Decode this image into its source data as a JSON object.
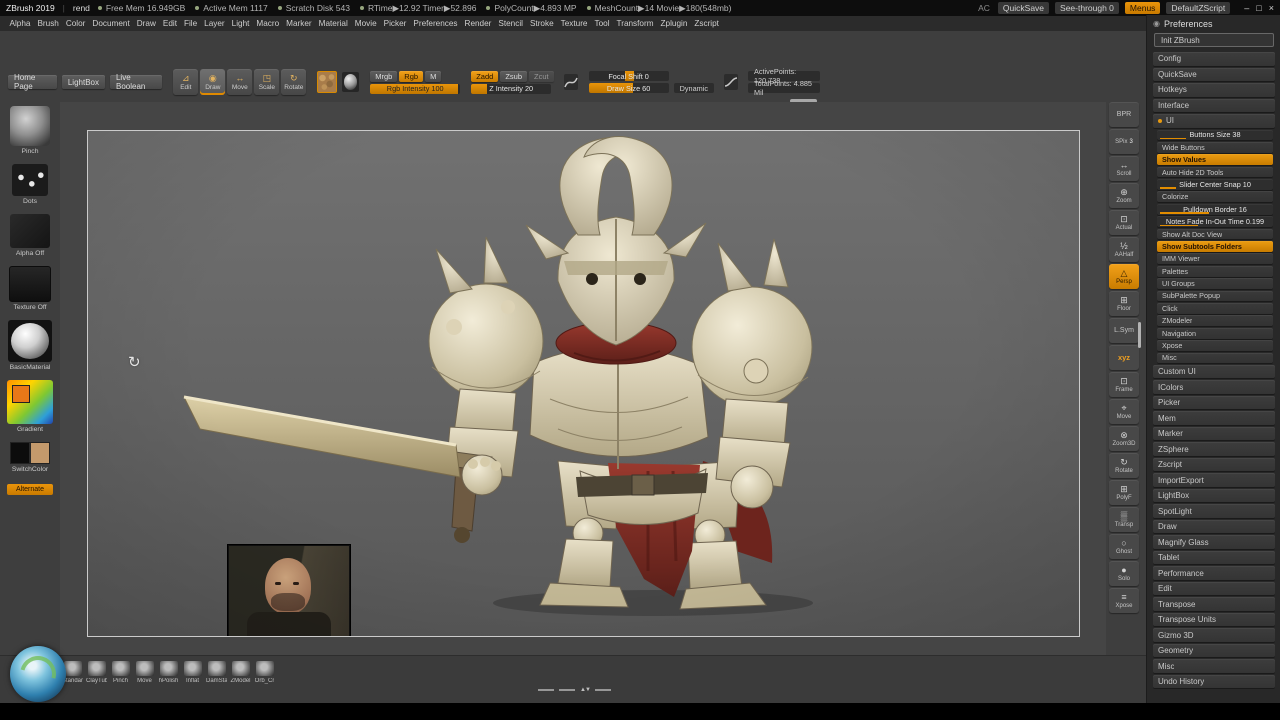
{
  "accent": "#d98a00",
  "titlebar": {
    "app_title": "ZBrush 2019",
    "doc_name": "rend",
    "stats": [
      "Free Mem 16.949GB",
      "Active Mem 1117",
      "Scratch Disk 543",
      "RTime▶12.92  Timer▶52.896",
      "PolyCount▶4.893 MP",
      "MeshCount▶14   Movie▶180(548mb)"
    ],
    "right_items": [
      {
        "label": "AC",
        "style": "plain"
      },
      {
        "label": "QuickSave"
      },
      {
        "label": "See-through 0"
      },
      {
        "label": "Menus",
        "style": "orange"
      },
      {
        "label": "DefaultZScript"
      }
    ],
    "window_controls": [
      "–",
      "□",
      "×"
    ]
  },
  "menubar": {
    "items": [
      "Alpha",
      "Brush",
      "Color",
      "Document",
      "Draw",
      "Edit",
      "File",
      "Layer",
      "Light",
      "Macro",
      "Marker",
      "Material",
      "Movie",
      "Picker",
      "Preferences",
      "Render",
      "Stencil",
      "Stroke",
      "Texture",
      "Tool",
      "Transform",
      "Zplugin",
      "Zscript"
    ]
  },
  "shelf": {
    "home_page": "Home Page",
    "lightbox": "LightBox",
    "live_boolean": "Live Boolean",
    "modes": [
      {
        "label": "Edit",
        "glyph": "⊿"
      },
      {
        "label": "Draw",
        "glyph": "◉",
        "active": true
      },
      {
        "label": "Move",
        "glyph": "↔"
      },
      {
        "label": "Scale",
        "glyph": "◳"
      },
      {
        "label": "Rotate",
        "glyph": "↻"
      }
    ],
    "color_modes": [
      {
        "label": "Mrgb"
      },
      {
        "label": "Rgb",
        "active": true
      },
      {
        "label": "M"
      }
    ],
    "rgb_intensity": "Rgb Intensity 100",
    "sculpt_modes": [
      {
        "label": "Zadd",
        "active": true
      },
      {
        "label": "Zsub"
      },
      {
        "label": "Zcut",
        "style": "dim"
      }
    ],
    "z_intensity": "Z Intensity 20",
    "focal_shift": "Focal Shift 0",
    "draw_size": "Draw Size 60",
    "dynamic": "Dynamic",
    "active_points": "ActivePoints: 120,738",
    "total_points": "TotalPoints: 4.885 Mil"
  },
  "left_panel": {
    "items": [
      {
        "label": "Pinch",
        "style": "brush"
      },
      {
        "label": "Dots",
        "style": "stroke"
      },
      {
        "label": "Alpha Off",
        "style": "alpha"
      },
      {
        "label": "Texture Off",
        "style": "texture"
      },
      {
        "label": "BasicMaterial",
        "style": "material"
      },
      {
        "label": "Gradient",
        "style": "colorpicker"
      },
      {
        "label": "SwitchColor",
        "style": "swatches"
      },
      {
        "label": "Alternate",
        "style": "orange"
      }
    ]
  },
  "right_dock": {
    "items": [
      {
        "label": "BPR",
        "style": "text"
      },
      {
        "label": "SPix",
        "value": "3"
      },
      {
        "label": "Scroll",
        "glyph": "↔"
      },
      {
        "label": "Zoom",
        "glyph": "⊕"
      },
      {
        "label": "Actual",
        "glyph": "⊡"
      },
      {
        "label": "AAHalf",
        "glyph": "½"
      },
      {
        "label": "Persp",
        "glyph": "△",
        "active": true
      },
      {
        "label": "Floor",
        "glyph": "⊞"
      },
      {
        "label": "L.Sym",
        "style": "text"
      },
      {
        "label": "xyz",
        "style": "text-orange"
      },
      {
        "label": "Frame",
        "glyph": "⊡"
      },
      {
        "label": "Move",
        "glyph": "⌖"
      },
      {
        "label": "Zoom3D",
        "glyph": "⊗"
      },
      {
        "label": "Rotate",
        "glyph": "↻"
      },
      {
        "label": "PolyF",
        "glyph": "⊞"
      },
      {
        "label": "Transp",
        "glyph": "▒"
      },
      {
        "label": "Ghost",
        "glyph": "○"
      },
      {
        "label": "Solo",
        "glyph": "●"
      },
      {
        "label": "Xpose",
        "glyph": "≡"
      }
    ]
  },
  "preferences": {
    "title": "Preferences",
    "menu_icon": "◉",
    "init_button": "Init ZBrush",
    "items": [
      {
        "label": "Config"
      },
      {
        "label": "QuickSave"
      },
      {
        "label": "Hotkeys"
      },
      {
        "label": "Interface"
      },
      {
        "label": "UI",
        "style": "section"
      },
      {
        "label": "Buttons Size 38",
        "style": "sub slider",
        "pct": 22
      },
      {
        "label": "Wide Buttons",
        "style": "sub"
      },
      {
        "label": "Show Values",
        "style": "sub orange"
      },
      {
        "label": "Auto Hide 2D Tools",
        "style": "sub"
      },
      {
        "label": "Slider Center Snap 10",
        "style": "sub slider",
        "pct": 14
      },
      {
        "label": "Colorize",
        "style": "sub"
      },
      {
        "label": "Pulldown Border 16",
        "style": "sub slider",
        "pct": 42
      },
      {
        "label": "Notes Fade In-Out Time 0.199",
        "style": "sub slider",
        "pct": 33
      },
      {
        "label": "Show Alt Doc View",
        "style": "sub"
      },
      {
        "label": "Show Subtools Folders",
        "style": "sub orange"
      },
      {
        "label": "IMM Viewer",
        "style": "sub"
      },
      {
        "label": "Palettes",
        "style": "sub"
      },
      {
        "label": "UI Groups",
        "style": "sub"
      },
      {
        "label": "SubPalette Popup",
        "style": "sub"
      },
      {
        "label": "Click",
        "style": "sub"
      },
      {
        "label": "ZModeler",
        "style": "sub"
      },
      {
        "label": "Navigation",
        "style": "sub"
      },
      {
        "label": "Xpose",
        "style": "sub"
      },
      {
        "label": "Misc",
        "style": "sub"
      },
      {
        "label": "Custom UI"
      },
      {
        "label": "IColors"
      },
      {
        "label": "Picker"
      },
      {
        "label": "Mem"
      },
      {
        "label": "Marker"
      },
      {
        "label": "ZSphere"
      },
      {
        "label": "Zscript"
      },
      {
        "label": "ImportExport"
      },
      {
        "label": "LightBox"
      },
      {
        "label": "SpotLight"
      },
      {
        "label": "Draw"
      },
      {
        "label": "Magnify Glass"
      },
      {
        "label": "Tablet"
      },
      {
        "label": "Performance"
      },
      {
        "label": "Edit"
      },
      {
        "label": "Transpose"
      },
      {
        "label": "Transpose Units"
      },
      {
        "label": "Gizmo 3D"
      },
      {
        "label": "Geometry"
      },
      {
        "label": "Misc"
      },
      {
        "label": "Undo History"
      }
    ]
  },
  "tray": {
    "brushes": [
      "Standar",
      "ClayTub",
      "Pinch",
      "Move",
      "hPolish",
      "Inflat",
      "DamSta",
      "ZModel",
      "Orb_Cr"
    ]
  },
  "canvas": {
    "rotate_cursor": "↻"
  },
  "icons": {
    "tray_arrows": "▲▼"
  }
}
